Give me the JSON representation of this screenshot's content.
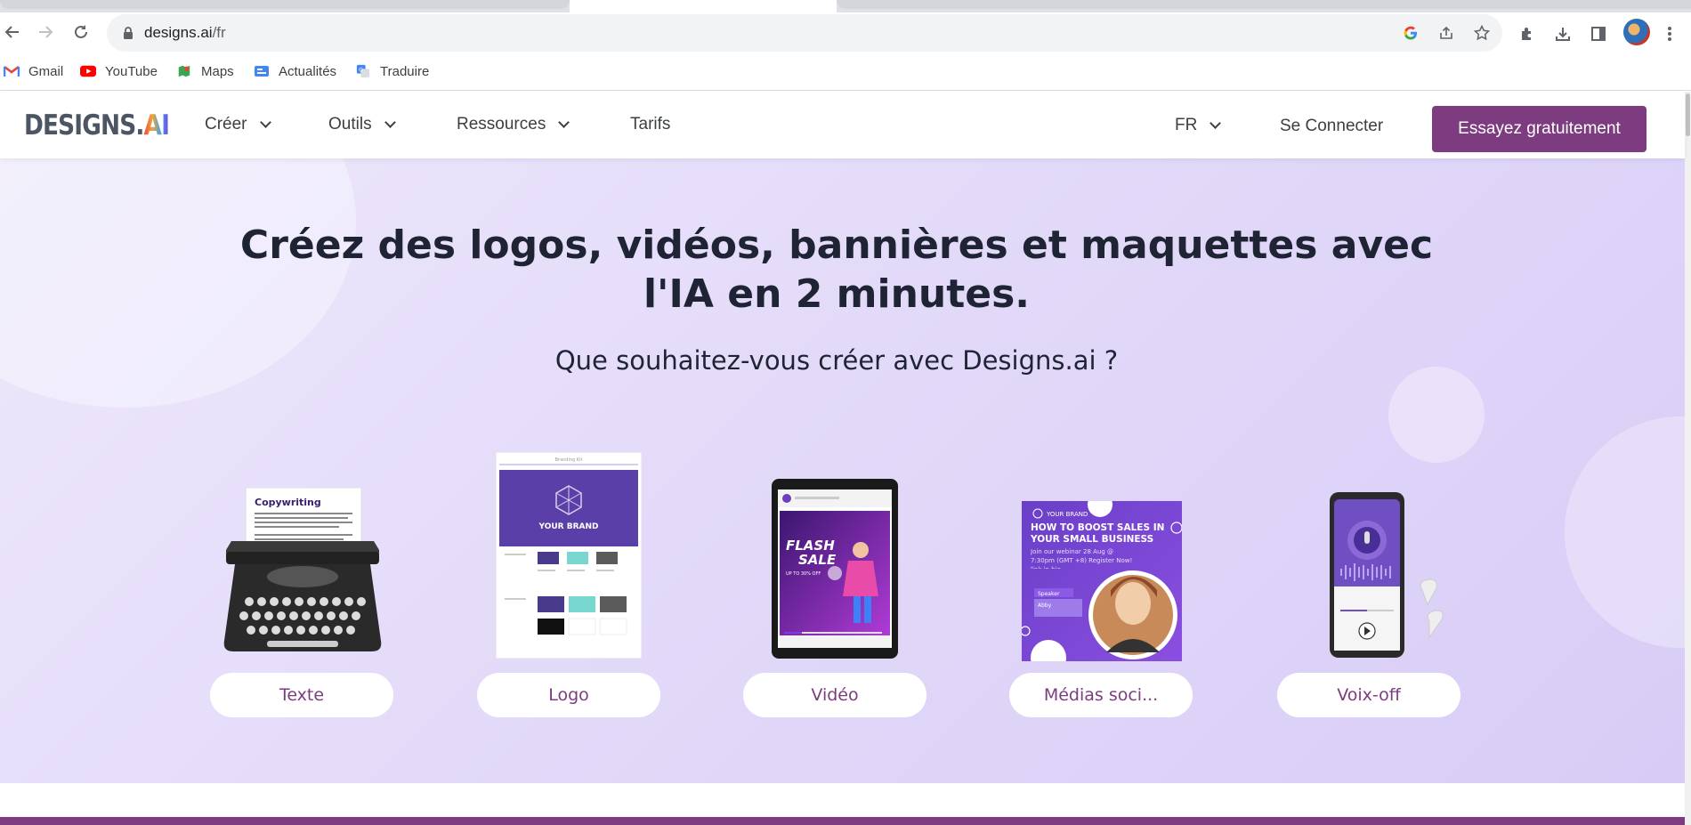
{
  "browser": {
    "url_domain": "designs.ai",
    "url_path": "/fr",
    "bookmarks": [
      {
        "label": "Gmail",
        "icon": "gmail-icon"
      },
      {
        "label": "YouTube",
        "icon": "youtube-icon"
      },
      {
        "label": "Maps",
        "icon": "maps-icon"
      },
      {
        "label": "Actualités",
        "icon": "news-icon"
      },
      {
        "label": "Traduire",
        "icon": "translate-icon"
      }
    ]
  },
  "header": {
    "logo_text": "DESIGNS.",
    "logo_ai": "AI",
    "menu": [
      {
        "label": "Créer",
        "has_dropdown": true
      },
      {
        "label": "Outils",
        "has_dropdown": true
      },
      {
        "label": "Ressources",
        "has_dropdown": true
      },
      {
        "label": "Tarifs",
        "has_dropdown": false
      }
    ],
    "language": "FR",
    "login_label": "Se Connecter",
    "cta_label": "Essayez gratuitement",
    "brand_color": "#7d3c7f"
  },
  "hero": {
    "title_line1": "Créez des logos, vidéos, bannières et maquettes avec",
    "title_line2": "l'IA en 2 minutes.",
    "subtitle": "Que souhaitez-vous créer avec Designs.ai ?",
    "cards": [
      {
        "label": "Texte",
        "doc_title": "Copywriting"
      },
      {
        "label": "Logo",
        "doc_title": "Branding Kit",
        "brand_text": "YOUR BRAND"
      },
      {
        "label": "Vidéo",
        "promo_line1": "FLASH",
        "promo_line2": "SALE",
        "promo_sub": "UP TO 30% OFF"
      },
      {
        "label": "Médias soci...",
        "brand_text": "YOUR BRAND",
        "headline": "HOW TO BOOST SALES IN YOUR SMALL BUSINESS",
        "detail": "Join our webinar 28 Aug @ 7:30pm (GMT +8) Register Now! link in bio",
        "speaker_label": "Speaker",
        "speaker_name": "Abby"
      },
      {
        "label": "Voix-off"
      }
    ]
  }
}
